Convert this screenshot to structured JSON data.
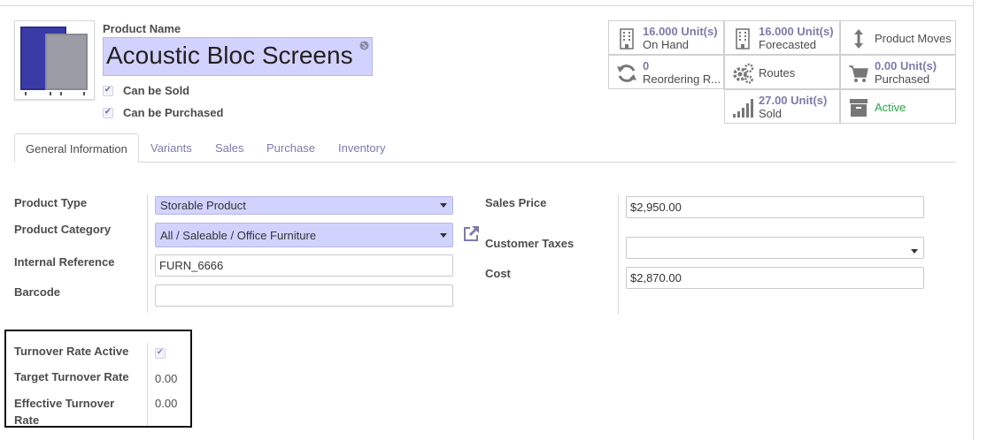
{
  "product": {
    "name_label": "Product Name",
    "name": "Acoustic Bloc Screens",
    "can_be_sold_label": "Can be Sold",
    "can_be_purchased_label": "Can be Purchased",
    "can_be_sold": true,
    "can_be_purchased": true
  },
  "stats": {
    "on_hand": {
      "value": "16.000",
      "unit": "Unit(s)",
      "label": "On Hand",
      "icon": "building-icon"
    },
    "forecasted": {
      "value": "16.000",
      "unit": "Unit(s)",
      "label": "Forecasted",
      "icon": "building-icon"
    },
    "moves": {
      "label": "Product Moves",
      "icon": "up-down-arrow-icon"
    },
    "reordering": {
      "value": "0",
      "label": "Reordering R...",
      "icon": "refresh-icon"
    },
    "routes": {
      "label": "Routes",
      "icon": "gears-icon"
    },
    "purchased": {
      "value": "0.00",
      "unit": "Unit(s)",
      "label": "Purchased",
      "icon": "cart-icon"
    },
    "sold": {
      "value": "27.00",
      "unit": "Unit(s)",
      "label": "Sold",
      "icon": "signal-bars-icon"
    },
    "active": {
      "label": "Active",
      "icon": "archive-icon"
    }
  },
  "tabs": [
    "General Information",
    "Variants",
    "Sales",
    "Purchase",
    "Inventory"
  ],
  "form": {
    "product_type_label": "Product Type",
    "product_type": "Storable Product",
    "product_category_label": "Product Category",
    "product_category": "All / Saleable / Office Furniture",
    "internal_reference_label": "Internal Reference",
    "internal_reference": "FURN_6666",
    "barcode_label": "Barcode",
    "barcode": "",
    "sales_price_label": "Sales Price",
    "sales_price": "$2,950.00",
    "customer_taxes_label": "Customer Taxes",
    "customer_taxes": "",
    "cost_label": "Cost",
    "cost": "$2,870.00"
  },
  "turnover": {
    "active_label": "Turnover Rate Active",
    "active": true,
    "target_label": "Target Turnover Rate",
    "target": "0.00",
    "effective_label_line1": "Effective Turnover",
    "effective_label_line2": "Rate",
    "effective": "0.00"
  },
  "colors": {
    "accent": "#7c7bad",
    "required_field": "#d2d2ff",
    "active_green": "#28a745"
  }
}
